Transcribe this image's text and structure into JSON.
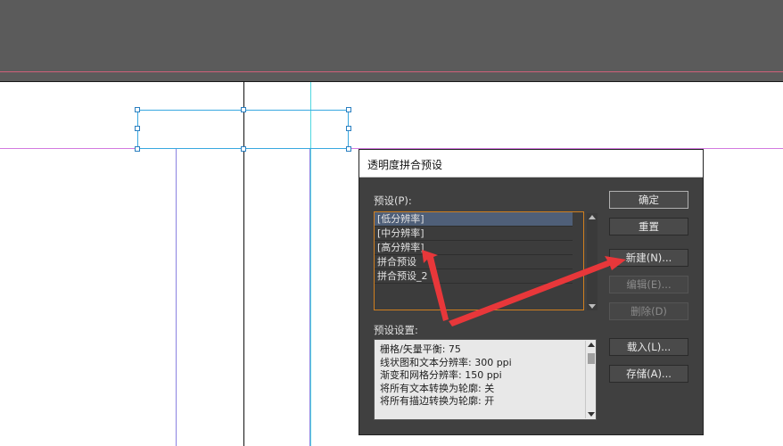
{
  "dialog": {
    "title": "透明度拼合预设",
    "preset_label": "预设(P):",
    "presets": [
      "[低分辨率]",
      "[中分辨率]",
      "[高分辨率]",
      "拼合预设",
      "拼合预设_2"
    ],
    "selected_index": 0,
    "settings_label": "预设设置:",
    "settings": [
      "栅格/矢量平衡: 75",
      "线状图和文本分辨率:  300 ppi",
      "渐变和网格分辨率:  150 ppi",
      "将所有文本转换为轮廓: 关",
      "将所有描边转换为轮廓: 开"
    ],
    "buttons": {
      "ok": "确定",
      "reset": "重置",
      "new": "新建(N)...",
      "edit": "编辑(E)...",
      "delete": "删除(D)",
      "load": "载入(L)...",
      "save": "存储(A)..."
    }
  },
  "colors": {
    "annotation_arrow": "#e8373a",
    "dialog_bg": "#404040",
    "list_focus_border": "#d07f1f",
    "selected_row": "#4f5f78"
  }
}
